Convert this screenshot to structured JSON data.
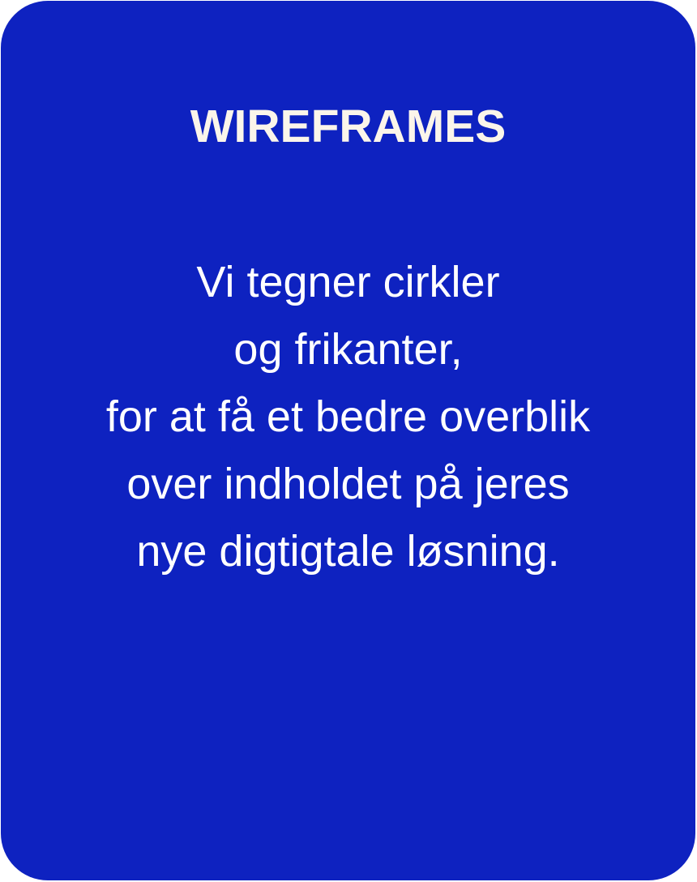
{
  "card": {
    "title": "WIREFRAMES",
    "body_lines": [
      "Vi tegner cirkler",
      "og frikanter,",
      "for at få et bedre overblik",
      "over indholdet på jeres",
      "nye digtigtale løsning."
    ]
  },
  "colors": {
    "card_background": "#0e22c0",
    "title_text": "#fbf5ea",
    "body_text": "#ffffff"
  }
}
